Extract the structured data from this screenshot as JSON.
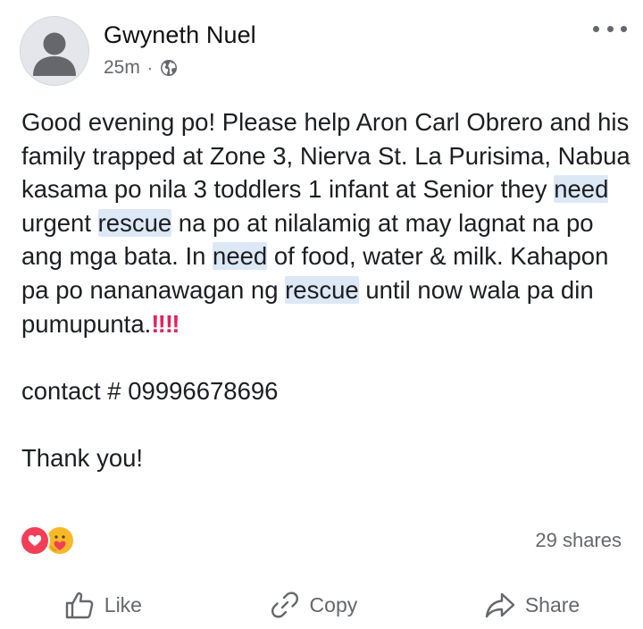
{
  "post": {
    "author": "Gwyneth Nuel",
    "time": "25m",
    "separator": "·",
    "privacy_icon": "globe-icon",
    "text": {
      "l1": "Good evening po! Please help Aron Carl Obrero and his family trapped at Zone 3, Nierva St. La Purisima, Nabua kasama po nila 3 toddlers 1 infant at Senior they ",
      "hl1": "need",
      "l2": " urgent ",
      "hl2": "rescue",
      "l3": " na po at nilalamig at may lagnat na po ang mga bata. In ",
      "hl3": "need",
      "l4": " of food, water & milk. Kahapon pa po nananawagan ng ",
      "hl4": "rescue",
      "l5": " until now wala pa din pumupunta.",
      "emoji": "‼‼",
      "contact": "contact # 09996678696",
      "thanks": "Thank you!"
    },
    "reactions": [
      "love-reaction",
      "care-reaction"
    ],
    "shares": "29 shares"
  },
  "actions": {
    "like": "Like",
    "copy": "Copy",
    "share": "Share"
  },
  "colors": {
    "highlight": "#dde8f7",
    "muted": "#65676b",
    "love": "#f33e58",
    "care": "#f7b928"
  }
}
